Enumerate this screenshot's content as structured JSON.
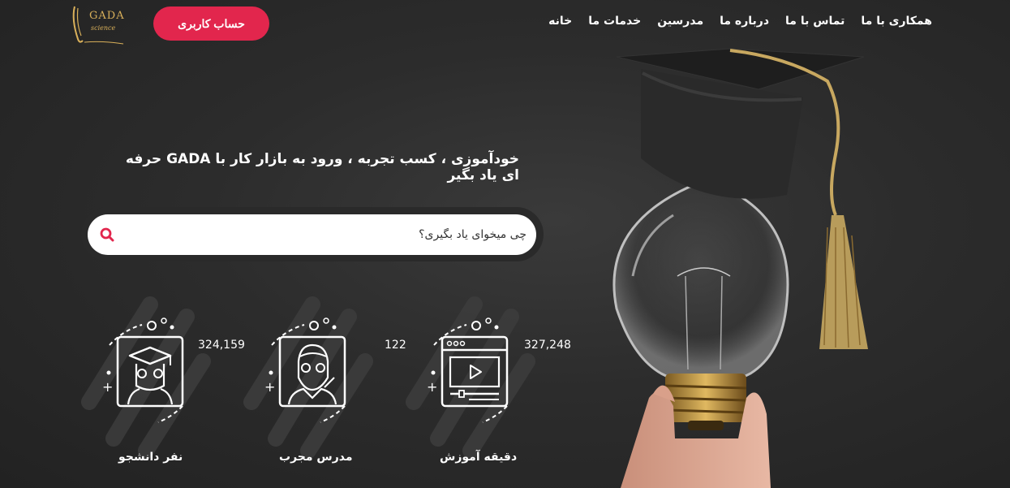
{
  "nav": {
    "items": [
      {
        "label": "خانه"
      },
      {
        "label": "خدمات ما"
      },
      {
        "label": "مدرسین"
      },
      {
        "label": "درباره ما"
      },
      {
        "label": "تماس با ما"
      },
      {
        "label": "همکاری با ما"
      }
    ]
  },
  "logo": {
    "text": "GADA",
    "sub": "science"
  },
  "account_button": "حساب کاربری",
  "headline": "خودآموزی ، کسب تجربه ، ورود به بازار کار با GADA حرفه ای یاد بگیر",
  "search": {
    "placeholder": "چی میخوای یاد بگیری؟"
  },
  "stats": [
    {
      "value": "327,248",
      "label": "دقیقه آموزش",
      "icon": "video-player-icon"
    },
    {
      "value": "122",
      "label": "مدرس مجرب",
      "icon": "teacher-icon"
    },
    {
      "value": "324,159",
      "label": "نفر دانشجو",
      "icon": "graduate-student-icon"
    }
  ],
  "colors": {
    "accent": "#e2264d",
    "gold": "#d9b05a",
    "background": "#2c2c2c"
  }
}
